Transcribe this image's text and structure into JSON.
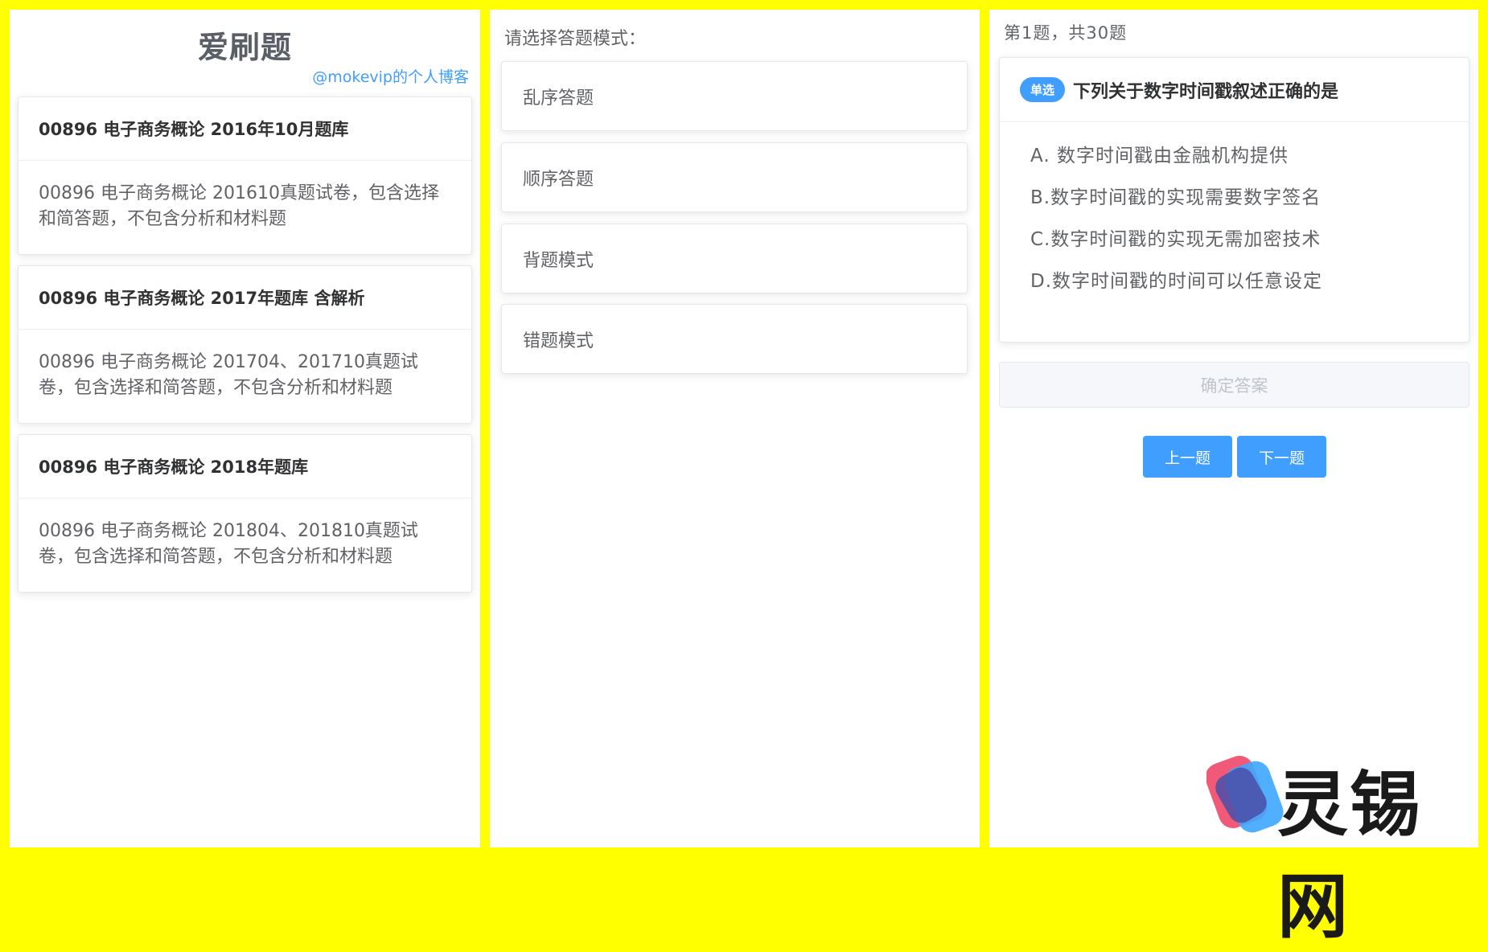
{
  "left": {
    "title": "爱刷题",
    "blog_link": "@mokevip的个人博客",
    "banks": [
      {
        "title": "00896 电子商务概论 2016年10月题库",
        "desc": "00896 电子商务概论 201610真题试卷，包含选择和简答题，不包含分析和材料题"
      },
      {
        "title": "00896 电子商务概论 2017年题库 含解析",
        "desc": "00896 电子商务概论 201704、201710真题试卷，包含选择和简答题，不包含分析和材料题"
      },
      {
        "title": "00896 电子商务概论 2018年题库",
        "desc": "00896 电子商务概论 201804、201810真题试卷，包含选择和简答题，不包含分析和材料题"
      }
    ]
  },
  "middle": {
    "prompt": "请选择答题模式：",
    "modes": [
      "乱序答题",
      "顺序答题",
      "背题模式",
      "错题模式"
    ]
  },
  "right": {
    "progress": "第1题，共30题",
    "question": {
      "type": "单选",
      "text": "下列关于数字时间戳叙述正确的是",
      "options": [
        "A. 数字时间戳由金融机构提供",
        "B.数字时间戳的实现需要数字签名",
        "C.数字时间戳的实现无需加密技术",
        "D.数字时间戳的时间可以任意设定"
      ]
    },
    "confirm_label": "确定答案",
    "prev_label": "上一题",
    "next_label": "下一题"
  },
  "watermark": {
    "text": "灵锡网"
  },
  "colors": {
    "frame": "#ffff00",
    "primary": "#409eff",
    "text": "#303133",
    "muted": "#606266"
  }
}
